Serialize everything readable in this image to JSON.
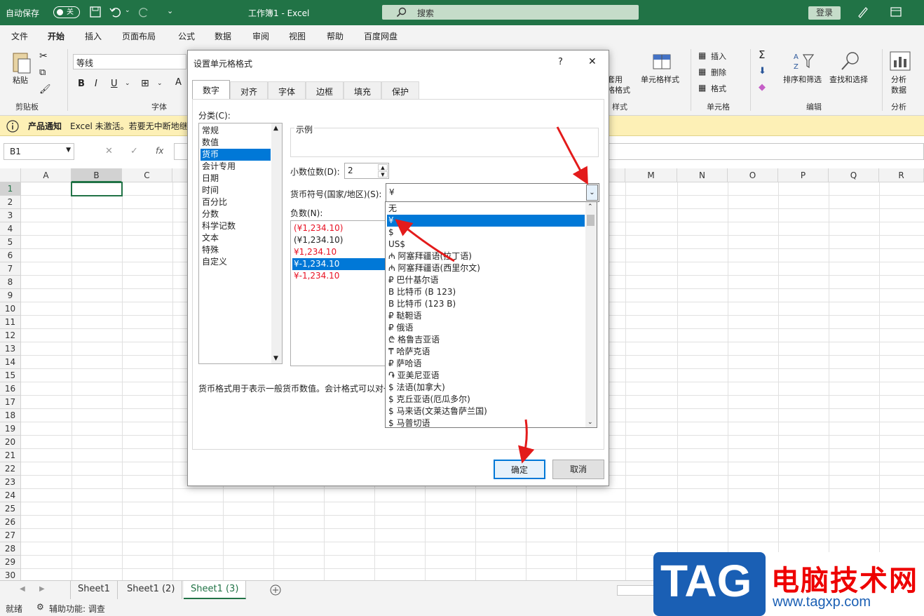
{
  "titlebar": {
    "autosave": "自动保存",
    "toggle": "关",
    "doc_title": "工作簿1  -  Excel",
    "search": "搜索",
    "login": "登录"
  },
  "menu": [
    "文件",
    "开始",
    "插入",
    "页面布局",
    "公式",
    "数据",
    "审阅",
    "视图",
    "帮助",
    "百度网盘"
  ],
  "ribbon": {
    "paste": "粘贴",
    "clipboard": "剪贴板",
    "font_name": "等线",
    "font_group": "字体",
    "bold": "B",
    "italic": "I",
    "underline": "U",
    "table_style": "套用",
    "table_style2": "格格式",
    "cell_style": "单元格样式",
    "style_group": "样式",
    "insert": "插入",
    "delete": "删除",
    "format": "格式",
    "cells_group": "单元格",
    "sort": "排序和筛选",
    "find": "查找和选择",
    "edit_group": "编辑",
    "analyze": "分析",
    "analyze2": "数据",
    "analyze_group": "分析"
  },
  "notice": {
    "title": "产品通知",
    "text": "Excel 未激活。若要无中断地继续"
  },
  "formula": {
    "namebox": "B1",
    "fx": "fx"
  },
  "columns": [
    "A",
    "B",
    "C",
    "M",
    "N",
    "O",
    "P",
    "Q",
    "R"
  ],
  "rows": [
    "1",
    "2",
    "3",
    "4",
    "5",
    "6",
    "7",
    "8",
    "9",
    "10",
    "11",
    "12",
    "13",
    "14",
    "15",
    "16",
    "17",
    "18",
    "19",
    "20",
    "21",
    "22",
    "23",
    "24",
    "25",
    "26",
    "27",
    "28",
    "29",
    "30"
  ],
  "sheets": [
    "Sheet1",
    "Sheet1 (2)",
    "Sheet1 (3)"
  ],
  "status": {
    "ready": "就绪",
    "accessibility": "辅助功能: 调查"
  },
  "dialog": {
    "title": "设置单元格格式",
    "help": "?",
    "close": "✕",
    "tabs": [
      "数字",
      "对齐",
      "字体",
      "边框",
      "填充",
      "保护"
    ],
    "category_label": "分类(C):",
    "categories": [
      "常规",
      "数值",
      "货币",
      "会计专用",
      "日期",
      "时间",
      "百分比",
      "分数",
      "科学记数",
      "文本",
      "特殊",
      "自定义"
    ],
    "sample_label": "示例",
    "decimals_label": "小数位数(D):",
    "decimals_value": "2",
    "symbol_label": "货币符号(国家/地区)(S):",
    "symbol_value": "¥",
    "negative_label": "负数(N):",
    "negatives": [
      "(¥1,234.10)",
      "(¥1,234.10)",
      "¥1,234.10",
      "¥-1,234.10",
      "¥-1,234.10"
    ],
    "description": "货币格式用于表示一般货币数值。会计格式可以对一",
    "ok": "确定",
    "cancel": "取消"
  },
  "symbols": [
    "无",
    "¥",
    "$",
    "US$",
    "₼ 阿塞拜疆语(拉丁语)",
    "₼ 阿塞拜疆语(西里尔文)",
    "₽ 巴什基尔语",
    "B 比特币 (B 123)",
    "B 比特币 (123 B)",
    "₽ 鞑靼语",
    "₽ 俄语",
    "₾ 格鲁吉亚语",
    "₸ 哈萨克语",
    "₽ 萨哈语",
    "֏ 亚美尼亚语",
    "$ 法语(加拿大)",
    "$ 克丘亚语(厄瓜多尔)",
    "$ 马来语(文莱达鲁萨兰国)",
    "$ 马普切语"
  ],
  "watermark": {
    "tag": "TAG",
    "site": "电脑技术网",
    "url": "www.tagxp.com"
  },
  "colors": {
    "excel_green": "#217346",
    "select_blue": "#0078d7",
    "arrow_red": "#e31b1b"
  }
}
